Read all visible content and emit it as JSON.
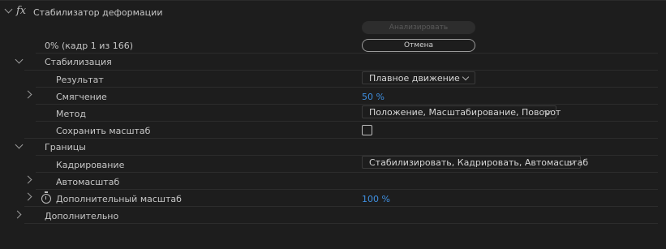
{
  "effect": {
    "fx_label": "fx",
    "title": "Стабилизатор деформации",
    "analyze_button": "Анализировать",
    "progress_text": "0% (кадр 1 из 166)",
    "cancel_button": "Отмена"
  },
  "stabilization": {
    "label": "Стабилизация",
    "result_label": "Результат",
    "result_value": "Плавное движение",
    "smoothness_label": "Смягчение",
    "smoothness_value": "50 %",
    "method_label": "Метод",
    "method_value": "Положение, Масштабирование, Поворот",
    "preserve_scale_label": "Сохранить масштаб",
    "preserve_scale_checked": false
  },
  "borders": {
    "label": "Границы",
    "framing_label": "Кадрирование",
    "framing_value": "Стабилизировать, Кадрировать, Автомасштаб",
    "autoscale_label": "Автомасштаб",
    "additional_scale_label": "Дополнительный масштаб",
    "additional_scale_value": "100 %"
  },
  "advanced": {
    "label": "Дополнительно"
  },
  "colors": {
    "background": "#1d1d1d",
    "value_blue": "#3f8fe0",
    "text": "#c6c6c6"
  }
}
